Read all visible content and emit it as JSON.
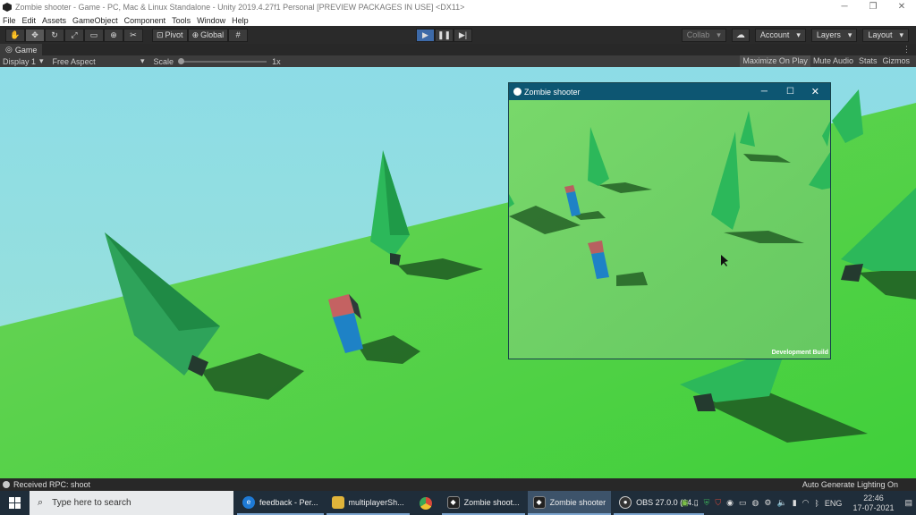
{
  "window": {
    "title": "Zombie shooter - Game - PC, Mac & Linux Standalone - Unity 2019.4.27f1 Personal [PREVIEW PACKAGES IN USE] <DX11>",
    "controls": [
      "─",
      "❐",
      "✕"
    ]
  },
  "menu": [
    "File",
    "Edit",
    "Assets",
    "GameObject",
    "Component",
    "Tools",
    "Window",
    "Help"
  ],
  "toolbar": {
    "pivot_label": "Pivot",
    "global_label": "Global",
    "collab_label": "Collab",
    "account_label": "Account",
    "layers_label": "Layers",
    "layout_label": "Layout"
  },
  "tab": {
    "label": "Game"
  },
  "game_bar": {
    "display": "Display 1",
    "aspect": "Free Aspect",
    "scale_label": "Scale",
    "scale_value": "1x",
    "maximize_label": "Maximize On Play",
    "mute_label": "Mute Audio",
    "stats_label": "Stats",
    "gizmos_label": "Gizmos"
  },
  "player_window": {
    "title": "Zombie shooter",
    "watermark": "Development Build"
  },
  "status": {
    "message": "Received RPC: shoot",
    "right": "Auto Generate Lighting On"
  },
  "taskbar": {
    "search_placeholder": "Type here to search",
    "apps": [
      {
        "label": "feedback - Per...",
        "color": "#1e7ad6"
      },
      {
        "label": "multiplayerSh...",
        "color": "#e0b43a"
      },
      {
        "label": "",
        "color": "#d9493a"
      },
      {
        "label": "Zombie shoot...",
        "color": "#222222"
      },
      {
        "label": "Zombie shooter",
        "color": "#222222"
      },
      {
        "label": "OBS 27.0.0 (64...",
        "color": "#333333"
      }
    ],
    "lang": "ENG",
    "time": "22:46",
    "date": "17-07-2021"
  },
  "colors": {
    "sky": "#8ad8e0",
    "ground": "#5ed64e",
    "tree": "#2bb55a",
    "play_accent": "#3d6aa8"
  }
}
